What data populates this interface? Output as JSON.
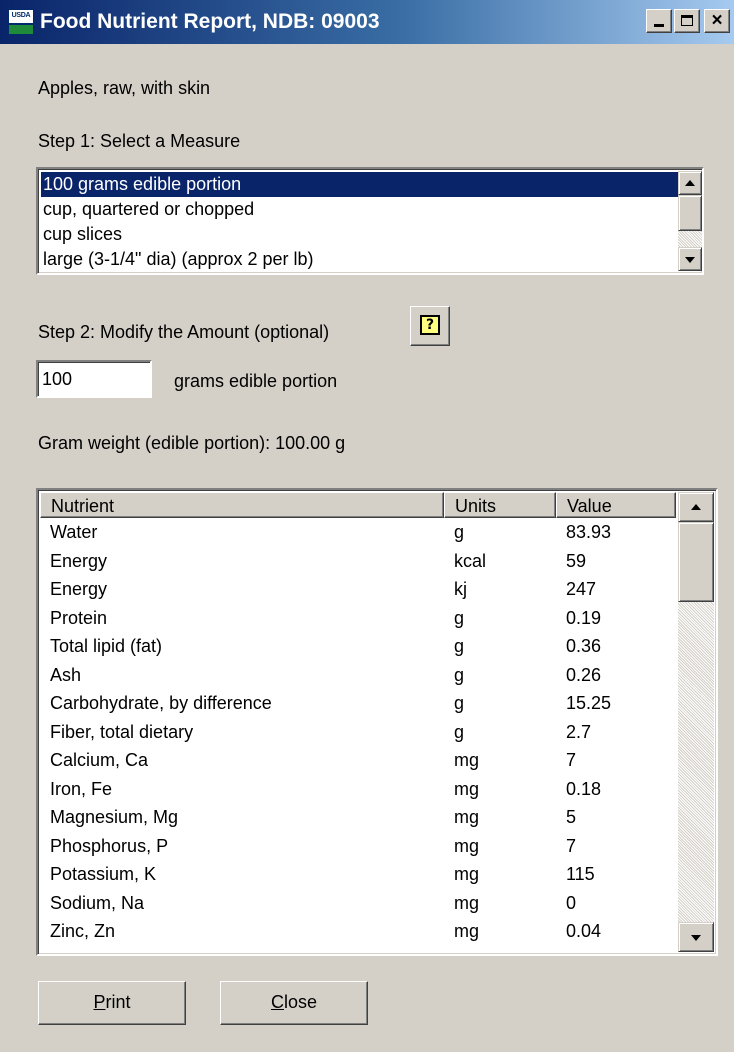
{
  "window": {
    "title": "Food Nutrient Report, NDB: 09003",
    "icon": "usda-icon",
    "icon_text": "USDA",
    "controls": {
      "minimize": "minimize",
      "maximize": "maximize",
      "close": "×"
    }
  },
  "food_name": "Apples, raw, with skin",
  "step1": {
    "label": "Step 1: Select a Measure",
    "options": [
      "100 grams edible portion",
      "cup, quartered or chopped",
      "cup slices",
      "large (3-1/4\" dia) (approx 2 per lb)"
    ],
    "selected": "100 grams edible portion"
  },
  "step2": {
    "label": "Step 2: Modify the Amount (optional)",
    "help_icon": "?",
    "amount": "100",
    "unit_label": "grams edible portion"
  },
  "gram_weight": "Gram weight (edible portion): 100.00 g",
  "table": {
    "headers": {
      "nutrient": "Nutrient",
      "units": "Units",
      "value": "Value"
    },
    "rows": [
      {
        "nutrient": "Water",
        "units": "g",
        "value": "83.93"
      },
      {
        "nutrient": "Energy",
        "units": "kcal",
        "value": "59"
      },
      {
        "nutrient": "Energy",
        "units": "kj",
        "value": "247"
      },
      {
        "nutrient": "Protein",
        "units": "g",
        "value": "0.19"
      },
      {
        "nutrient": "Total lipid (fat)",
        "units": "g",
        "value": "0.36"
      },
      {
        "nutrient": "Ash",
        "units": "g",
        "value": "0.26"
      },
      {
        "nutrient": "Carbohydrate, by difference",
        "units": "g",
        "value": "15.25"
      },
      {
        "nutrient": "Fiber, total dietary",
        "units": "g",
        "value": "2.7"
      },
      {
        "nutrient": "Calcium, Ca",
        "units": "mg",
        "value": "7"
      },
      {
        "nutrient": "Iron, Fe",
        "units": "mg",
        "value": "0.18"
      },
      {
        "nutrient": "Magnesium, Mg",
        "units": "mg",
        "value": "5"
      },
      {
        "nutrient": "Phosphorus, P",
        "units": "mg",
        "value": "7"
      },
      {
        "nutrient": "Potassium, K",
        "units": "mg",
        "value": "115"
      },
      {
        "nutrient": "Sodium, Na",
        "units": "mg",
        "value": "0"
      },
      {
        "nutrient": "Zinc, Zn",
        "units": "mg",
        "value": "0.04"
      }
    ]
  },
  "buttons": {
    "print": {
      "label": "rint",
      "accel": "P"
    },
    "close": {
      "label": "lose",
      "accel": "C"
    }
  }
}
